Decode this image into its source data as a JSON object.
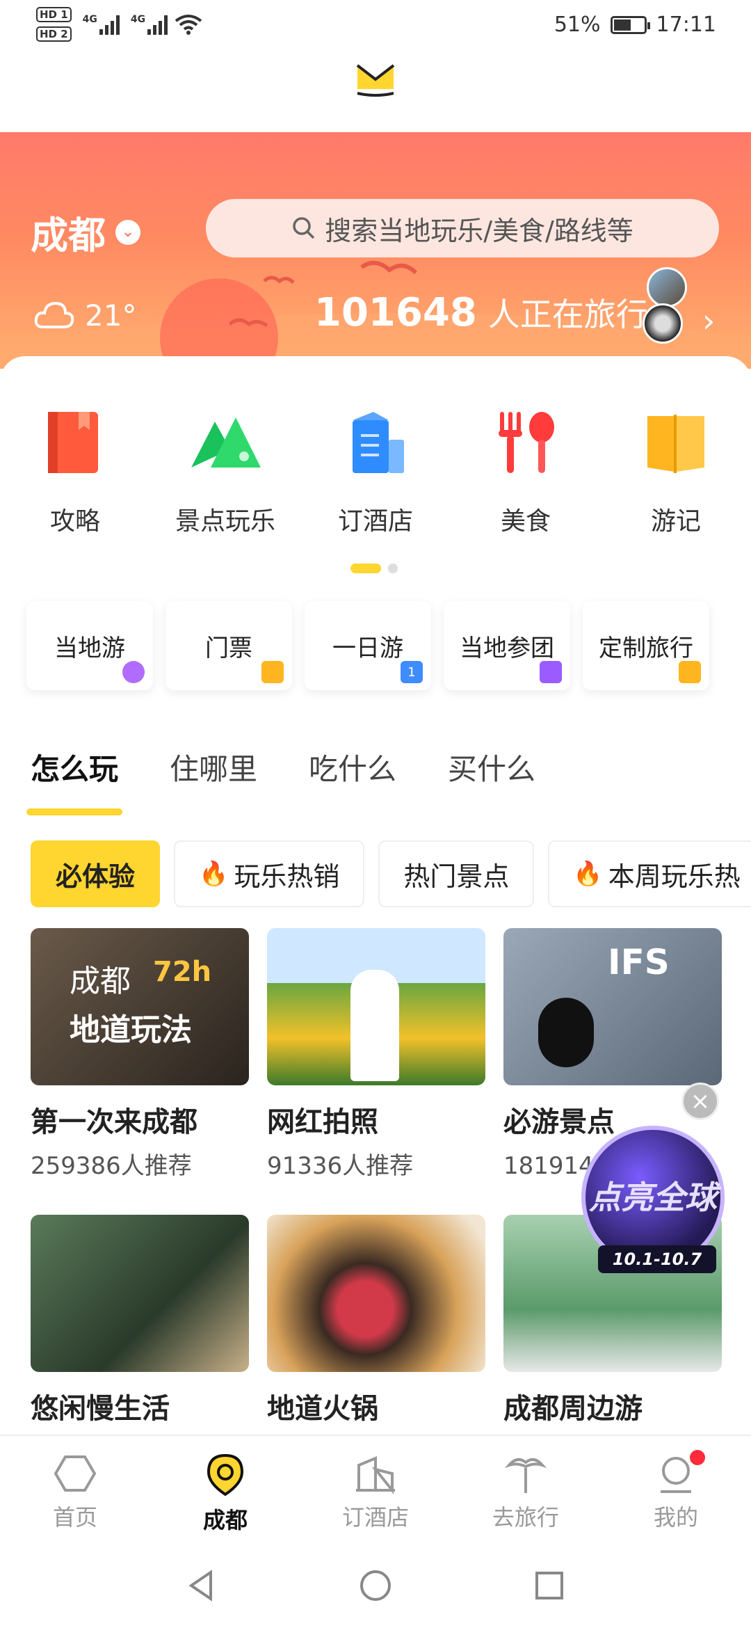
{
  "status_bar": {
    "hd1": "HD 1",
    "hd2": "HD 2",
    "network1": "4G",
    "network2": "4G",
    "battery": "51%",
    "time": "17:11"
  },
  "banner": {
    "city": "成都",
    "search_placeholder": "搜索当地玩乐/美食/路线等",
    "temperature": "21°",
    "travelers_count": "101648",
    "travelers_text": "人正在旅行"
  },
  "quick_actions": [
    {
      "label": "攻略",
      "icon": "guide-book-icon"
    },
    {
      "label": "景点玩乐",
      "icon": "mountain-icon"
    },
    {
      "label": "订酒店",
      "icon": "hotel-building-icon"
    },
    {
      "label": "美食",
      "icon": "fork-spoon-icon"
    },
    {
      "label": "游记",
      "icon": "open-book-icon"
    }
  ],
  "chips": [
    {
      "label": "当地游",
      "color": "#b06cff"
    },
    {
      "label": "门票",
      "color": "#ffb51f"
    },
    {
      "label": "一日游",
      "color": "#3e8cff"
    },
    {
      "label": "当地参团",
      "color": "#9a5cff"
    },
    {
      "label": "定制旅行",
      "color": "#ffb51f"
    }
  ],
  "tabs": [
    "怎么玩",
    "住哪里",
    "吃什么",
    "买什么"
  ],
  "pills": [
    {
      "label": "必体验"
    },
    {
      "label": "玩乐热销"
    },
    {
      "label": "热门景点"
    },
    {
      "label": "本周玩乐热"
    }
  ],
  "tiles": [
    {
      "title": "第一次来成都",
      "sub": "259386人推荐",
      "overlay1": "成都",
      "overlay2": "72h",
      "overlay3": "地道玩法"
    },
    {
      "title": "网红拍照",
      "sub": "91336人推荐"
    },
    {
      "title": "必游景点",
      "sub": "181914人推荐",
      "overlay1": "IFS"
    },
    {
      "title": "悠闲慢生活",
      "sub": ""
    },
    {
      "title": "地道火锅",
      "sub": ""
    },
    {
      "title": "成都周边游",
      "sub": ""
    }
  ],
  "promo": {
    "text": "点亮全球",
    "dates": "10.1-10.7"
  },
  "bottom_nav": [
    {
      "label": "首页"
    },
    {
      "label": "成都"
    },
    {
      "label": "订酒店"
    },
    {
      "label": "去旅行"
    },
    {
      "label": "我的"
    }
  ],
  "colors": {
    "accent": "#ffd530",
    "banner": "#ff7a6a",
    "notify": "#ff2a3a"
  }
}
